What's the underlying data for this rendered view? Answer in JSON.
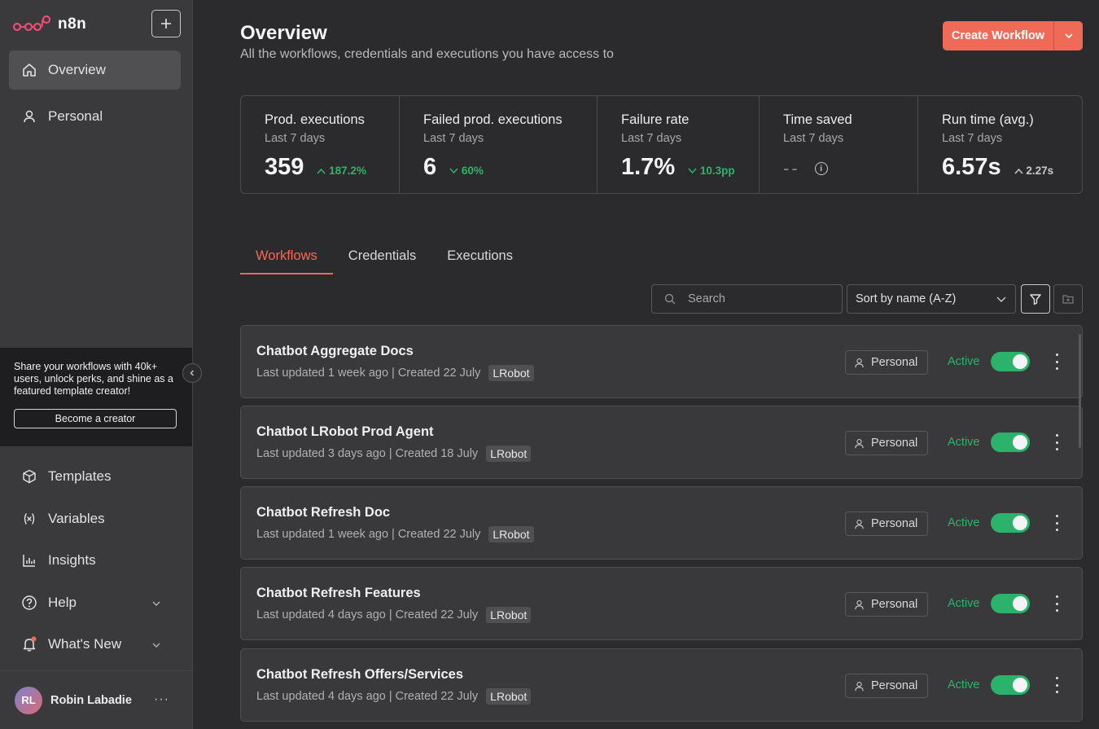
{
  "app": {
    "name": "n8n"
  },
  "sidebar": {
    "top_items": [
      {
        "label": "Overview",
        "icon": "home-icon",
        "active": true
      },
      {
        "label": "Personal",
        "icon": "user-icon",
        "active": false
      }
    ],
    "promo": {
      "text": "Share your workflows with 40k+ users, unlock perks, and shine as a featured template creator!",
      "button": "Become a creator"
    },
    "bottom_items": [
      {
        "label": "Templates",
        "icon": "box-icon"
      },
      {
        "label": "Variables",
        "icon": "variable-icon"
      },
      {
        "label": "Insights",
        "icon": "chart-icon"
      },
      {
        "label": "Help",
        "icon": "help-circle-icon"
      },
      {
        "label": "What's New",
        "icon": "bell-icon"
      }
    ],
    "user": {
      "initials": "RL",
      "name": "Robin Labadie"
    }
  },
  "header": {
    "title": "Overview",
    "subtitle": "All the workflows, credentials and executions you have access to",
    "create_button": "Create Workflow"
  },
  "stats": [
    {
      "title": "Prod. executions",
      "period": "Last 7 days",
      "value": "359",
      "delta": "187.2%",
      "direction": "up"
    },
    {
      "title": "Failed prod. executions",
      "period": "Last 7 days",
      "value": "6",
      "delta": "60%",
      "direction": "down"
    },
    {
      "title": "Failure rate",
      "period": "Last 7 days",
      "value": "1.7%",
      "delta": "10.3pp",
      "direction": "down"
    },
    {
      "title": "Time saved",
      "period": "Last 7 days",
      "value": "--",
      "delta": "",
      "direction": "none"
    },
    {
      "title": "Run time (avg.)",
      "period": "Last 7 days",
      "value": "6.57s",
      "delta": "2.27s",
      "direction": "up"
    }
  ],
  "tabs": [
    {
      "label": "Workflows",
      "active": true
    },
    {
      "label": "Credentials",
      "active": false
    },
    {
      "label": "Executions",
      "active": false
    }
  ],
  "toolbar": {
    "search_placeholder": "Search",
    "sort_value": "Sort by name (A-Z)"
  },
  "workflows": [
    {
      "name": "Chatbot Aggregate Docs",
      "updated": "Last updated 1 week ago",
      "created": "Created 22 July",
      "tag": "LRobot",
      "owner": "Personal",
      "status": "Active"
    },
    {
      "name": "Chatbot LRobot Prod Agent",
      "updated": "Last updated 3 days ago",
      "created": "Created 18 July",
      "tag": "LRobot",
      "owner": "Personal",
      "status": "Active"
    },
    {
      "name": "Chatbot Refresh Doc",
      "updated": "Last updated 1 week ago",
      "created": "Created 22 July",
      "tag": "LRobot",
      "owner": "Personal",
      "status": "Active"
    },
    {
      "name": "Chatbot Refresh Features",
      "updated": "Last updated 4 days ago",
      "created": "Created 22 July",
      "tag": "LRobot",
      "owner": "Personal",
      "status": "Active"
    },
    {
      "name": "Chatbot Refresh Offers/Services",
      "updated": "Last updated 4 days ago",
      "created": "Created 22 July",
      "tag": "LRobot",
      "owner": "Personal",
      "status": "Active"
    }
  ],
  "colors": {
    "accent": "#f06a58",
    "success": "#2cb36b",
    "background": "#2b2b2d",
    "sidebar": "#3a3a3c"
  }
}
